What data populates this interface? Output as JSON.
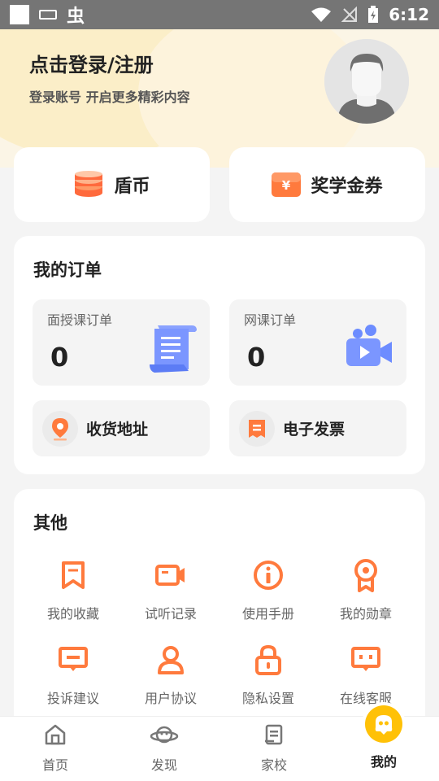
{
  "status_bar": {
    "time": "6:12",
    "app_glyph": "虫"
  },
  "header": {
    "login_title": "点击登录/注册",
    "login_subtitle": "登录账号 开启更多精彩内容"
  },
  "wallet": {
    "coins_label": "盾币",
    "scholarship_label": "奖学金券"
  },
  "orders": {
    "title": "我的订单",
    "offline": {
      "label": "面授课订单",
      "count": "0"
    },
    "online": {
      "label": "网课订单",
      "count": "0"
    },
    "address_label": "收货地址",
    "invoice_label": "电子发票"
  },
  "other": {
    "title": "其他",
    "items": [
      {
        "label": "我的收藏",
        "icon": "bookmark-icon"
      },
      {
        "label": "试听记录",
        "icon": "video-record-icon"
      },
      {
        "label": "使用手册",
        "icon": "info-icon"
      },
      {
        "label": "我的勋章",
        "icon": "medal-icon"
      },
      {
        "label": "投诉建议",
        "icon": "feedback-icon"
      },
      {
        "label": "用户协议",
        "icon": "user-icon"
      },
      {
        "label": "隐私设置",
        "icon": "lock-icon"
      },
      {
        "label": "在线客服",
        "icon": "chat-icon"
      }
    ]
  },
  "nav": {
    "items": [
      {
        "label": "首页",
        "icon": "home-icon"
      },
      {
        "label": "发现",
        "icon": "planet-icon"
      },
      {
        "label": "家校",
        "icon": "notebook-icon"
      },
      {
        "label": "我的",
        "icon": "profile-icon"
      }
    ],
    "active_index": 3
  },
  "colors": {
    "accent_orange": "#ff7a3d",
    "header_bg": "#fbf5e6",
    "active_yellow": "#ffc107",
    "blue_icon": "#6c8cff"
  }
}
